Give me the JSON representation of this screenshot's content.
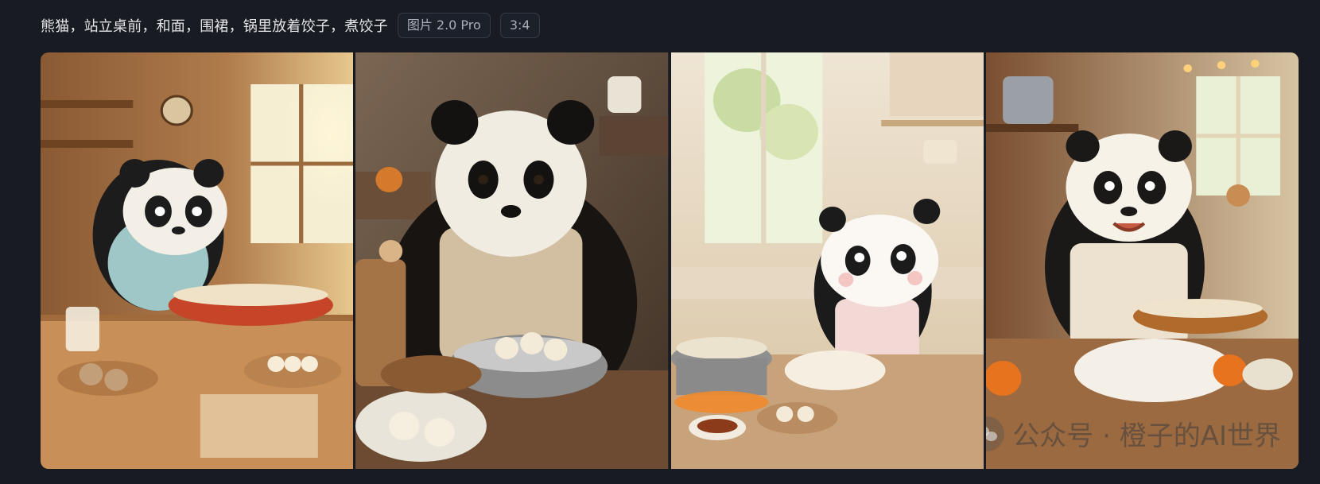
{
  "header": {
    "prompt": "熊猫，站立桌前，和面，围裙，锅里放着饺子，煮饺子",
    "model_tag": "图片 2.0 Pro",
    "ratio_tag": "3:4"
  },
  "gallery": {
    "watermark_text": "公众号 · 橙子的AI世界",
    "watermark_icon": "wechat-icon"
  }
}
